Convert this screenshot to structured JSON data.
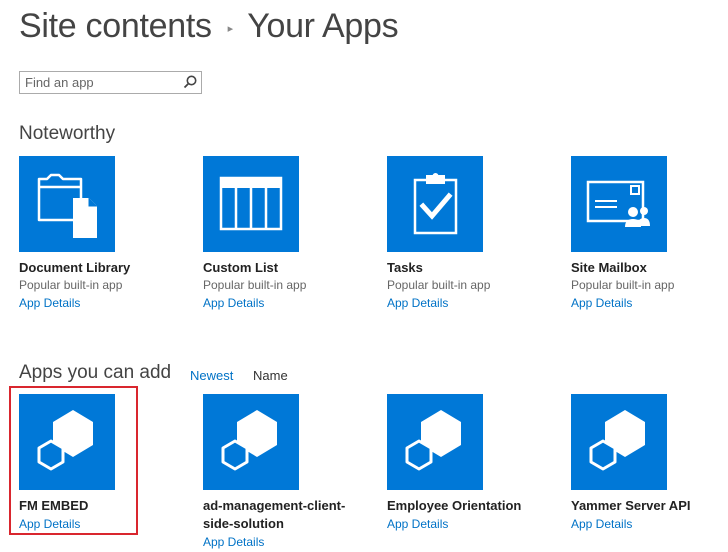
{
  "breadcrumb": {
    "parent": "Site contents",
    "current": "Your Apps"
  },
  "search": {
    "placeholder": "Find an app",
    "value": ""
  },
  "noteworthy": {
    "heading": "Noteworthy",
    "apps": [
      {
        "title": "Document Library",
        "subtitle": "Popular built-in app",
        "details": "App Details",
        "icon": "document-library-icon"
      },
      {
        "title": "Custom List",
        "subtitle": "Popular built-in app",
        "details": "App Details",
        "icon": "custom-list-icon"
      },
      {
        "title": "Tasks",
        "subtitle": "Popular built-in app",
        "details": "App Details",
        "icon": "tasks-icon"
      },
      {
        "title": "Site Mailbox",
        "subtitle": "Popular built-in app",
        "details": "App Details",
        "icon": "site-mailbox-icon"
      }
    ]
  },
  "apps_you_can_add": {
    "heading": "Apps you can add",
    "sort": {
      "newest": "Newest",
      "name": "Name",
      "active": "newest"
    },
    "apps": [
      {
        "title": "FM EMBED",
        "details": "App Details",
        "icon": "app-cube-icon",
        "highlighted": true
      },
      {
        "title_line1": "ad-management-client-",
        "title_line2": "side-solution",
        "details": "App Details",
        "icon": "app-cube-icon"
      },
      {
        "title": "Employee Orientation",
        "details": "App Details",
        "icon": "app-cube-icon"
      },
      {
        "title": "Yammer Server API",
        "details": "App Details",
        "icon": "app-cube-icon"
      }
    ]
  },
  "colors": {
    "tile": "#0078d7",
    "link": "#0072c6",
    "highlight": "#d9262e"
  }
}
